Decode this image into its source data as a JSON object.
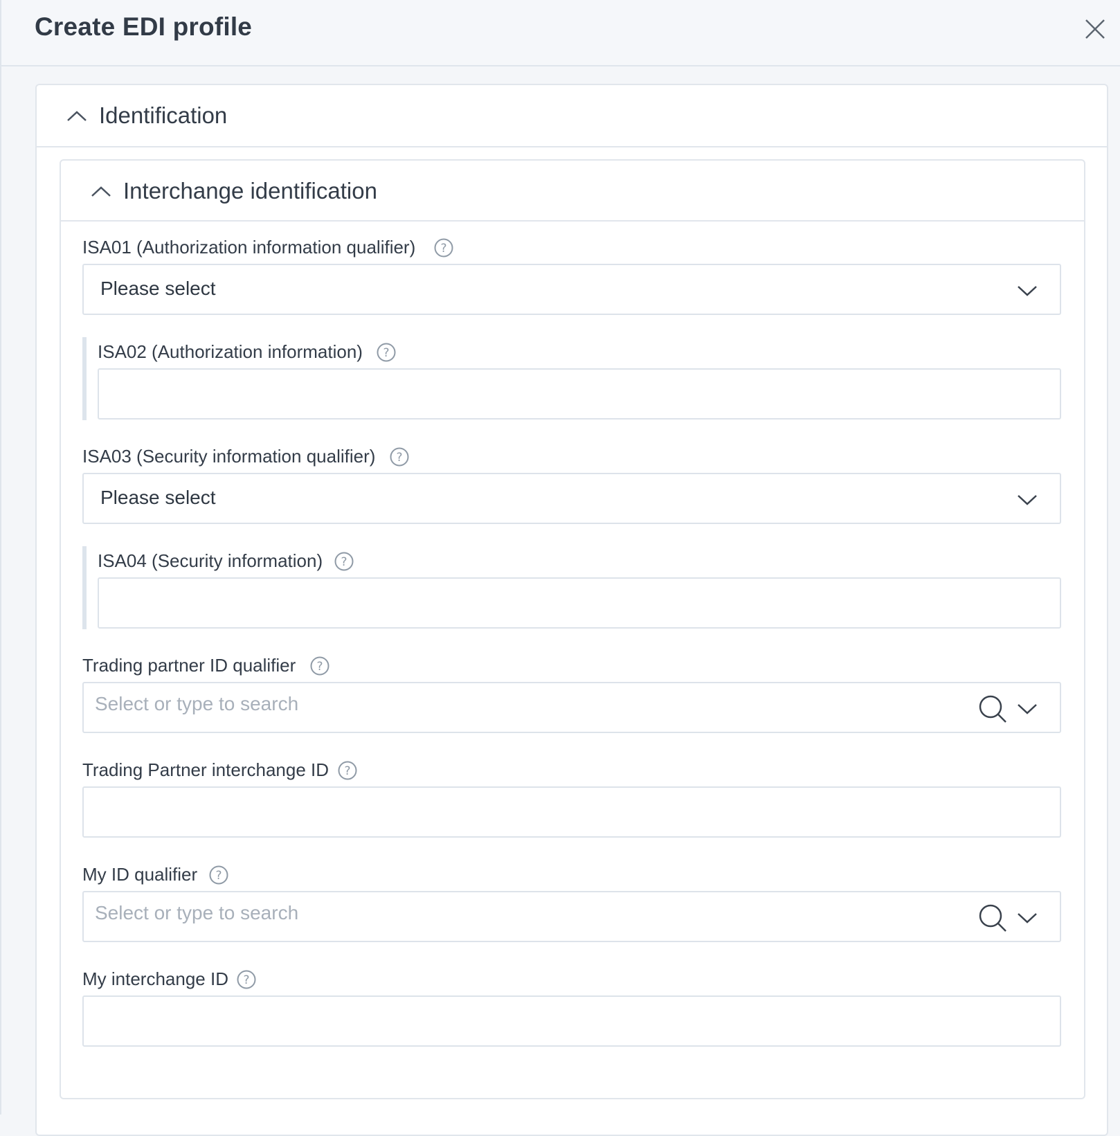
{
  "modal": {
    "title": "Create EDI profile",
    "close_icon": "close-icon"
  },
  "sections": {
    "identification": {
      "label": "Identification",
      "icon": "chevron-up-icon"
    },
    "interchange": {
      "label": "Interchange identification",
      "icon": "chevron-up-icon"
    }
  },
  "fields": {
    "isa01": {
      "label": "ISA01 (Authorization information qualifier)",
      "value": "Please select",
      "icon": "help-icon"
    },
    "isa02": {
      "label": "ISA02 (Authorization information)",
      "value": "",
      "icon": "help-icon"
    },
    "isa03": {
      "label": "ISA03 (Security information qualifier)",
      "value": "Please select",
      "icon": "help-icon"
    },
    "isa04": {
      "label": "ISA04 (Security information)",
      "value": "",
      "icon": "help-icon"
    },
    "tp_qualifier": {
      "label": "Trading partner ID qualifier",
      "placeholder": "Select or type to search",
      "icon": "help-icon"
    },
    "tp_interchange_id": {
      "label": "Trading Partner interchange ID",
      "value": "",
      "icon": "help-icon"
    },
    "my_qualifier": {
      "label": "My ID qualifier",
      "placeholder": "Select or type to search",
      "icon": "help-icon"
    },
    "my_interchange_id": {
      "label": "My interchange ID",
      "value": "",
      "icon": "help-icon"
    }
  },
  "colors": {
    "border": "#dde3ea",
    "text": "#2e3742",
    "placeholder": "#a8b0ba",
    "help_icon": "#8f9aa6"
  }
}
